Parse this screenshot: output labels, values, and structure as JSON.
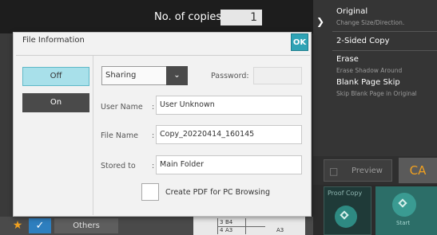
{
  "background": {
    "copies_label": "No. of copies",
    "copies_value": "1",
    "right_panel": [
      {
        "title": "Original",
        "subtitle": "Change Size/Direction."
      },
      {
        "title": "2-Sided Copy",
        "subtitle": ""
      },
      {
        "title": "Erase",
        "subtitle": "Erase Shadow Around"
      },
      {
        "title": "Blank Page Skip",
        "subtitle": "Skip Blank Page in Original"
      }
    ],
    "preview_label": "Preview",
    "ca_label": "CA",
    "proof_label": "Proof Copy",
    "start_label": "Start",
    "others_label": "Others",
    "paper": {
      "b4": "B4",
      "a3_top": "A3",
      "a3_right": "A3",
      "n3": "3",
      "n4": "4"
    }
  },
  "dialog": {
    "title": "File Information",
    "ok_label": "OK",
    "off_label": "Off",
    "on_label": "On",
    "sharing_value": "Sharing",
    "password_label": "Password:",
    "password_value": "",
    "fields": {
      "user_name": {
        "label": "User Name",
        "value": "User Unknown"
      },
      "file_name": {
        "label": "File Name",
        "value": "Copy_20220414_160145"
      },
      "stored_to": {
        "label": "Stored to",
        "value": "Main Folder"
      }
    },
    "pdf_checkbox_label": "Create PDF for PC Browsing",
    "pdf_checked": false
  }
}
